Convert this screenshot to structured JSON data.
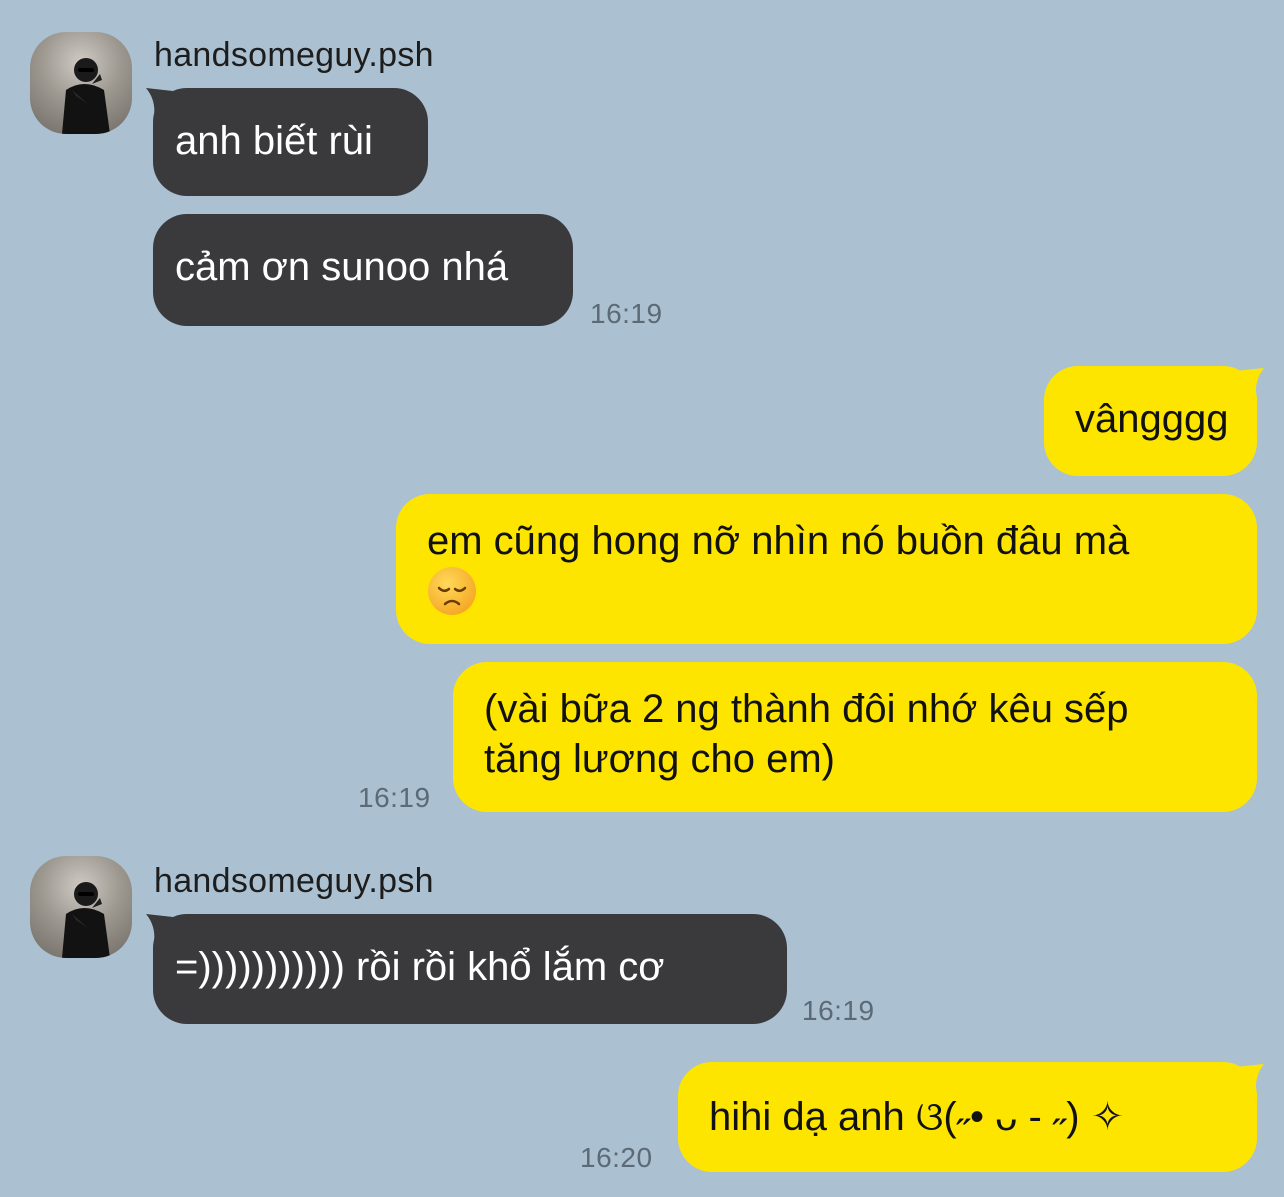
{
  "messages": [
    {
      "sender": "handsomeguy.psh",
      "text": "anh biết rùi"
    },
    {
      "text": "cảm ơn sunoo nhá",
      "time": "16:19"
    },
    {
      "text": "vângggg"
    },
    {
      "text": "em cũng hong nỡ nhìn nó buồn đâu mà",
      "emoji": "disappointed-face-emoji"
    },
    {
      "line1": "(vài bữa 2 ng thành đôi nhớ kêu sếp",
      "line2": "tăng lương cho em)",
      "time": "16:19"
    },
    {
      "sender": "handsomeguy.psh",
      "text": "=))))))))))) rồi rồi khổ lắm cơ",
      "time": "16:19"
    },
    {
      "text": "hihi dạ anh  ଓ(˶• ᴗ - ˶) ✧",
      "time": "16:20"
    }
  ],
  "colors": {
    "background": "#abc1d1",
    "incoming_bubble": "#3a3a3c",
    "outgoing_bubble": "#fee500",
    "timestamp": "#5b6a76"
  }
}
